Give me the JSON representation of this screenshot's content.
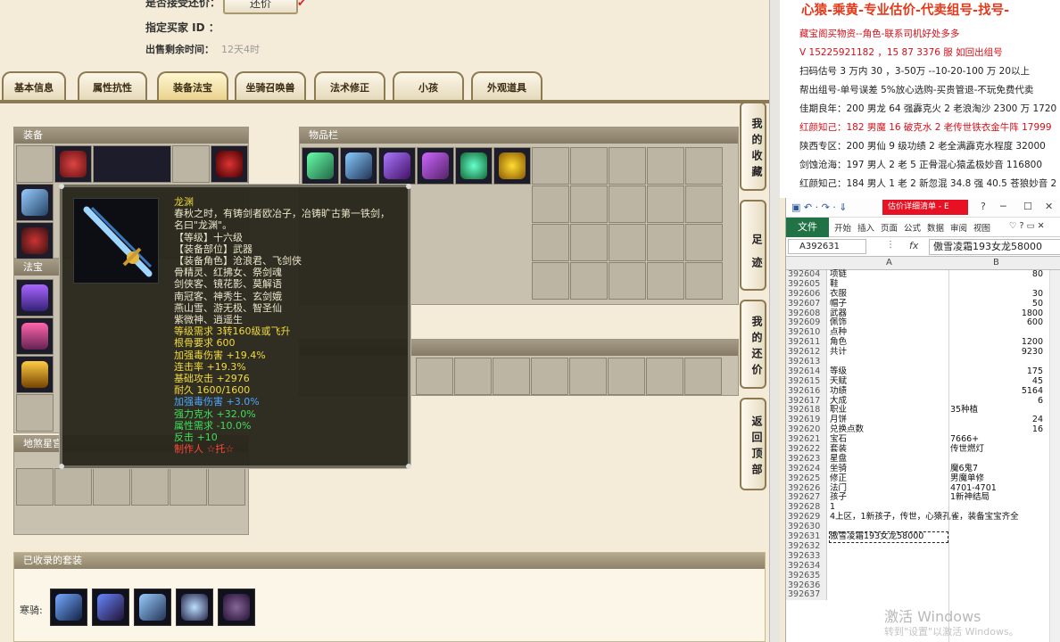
{
  "trade_info": {
    "accept_counter_label": "是否接受还价：",
    "counter_button": "还价",
    "counter_mark": "✔",
    "buyer_label": "指定买家 ID ：",
    "remaining_label": "出售剩余时间：",
    "remaining_value": "12天4时"
  },
  "tabs": [
    {
      "label": "基本信息"
    },
    {
      "label": "属性抗性"
    },
    {
      "label": "装备法宝"
    },
    {
      "label": "坐骑召唤兽"
    },
    {
      "label": "法术修正"
    },
    {
      "label": "小孩"
    },
    {
      "label": "外观道具"
    }
  ],
  "panels": {
    "equipment": "装备",
    "treasure": "法宝",
    "star_palace": "地煞星宫",
    "inventory": "物品栏",
    "collected_sets": "已收录的套装",
    "set_name": "寒骑:"
  },
  "side_buttons": {
    "favorites": "我的收藏",
    "footprints": "足迹",
    "my_offers": "我的还价",
    "back_top": "返回顶部"
  },
  "tooltip": {
    "name": "龙渊",
    "lines": [
      {
        "text": "春秋之时，有铸剑者欧冶子，冶铸旷古第一铁剑，",
        "color": "c-white"
      },
      {
        "text": "名曰\"龙渊\"。",
        "color": "c-white"
      },
      {
        "text": "【等级】十六级",
        "color": "c-white"
      },
      {
        "text": "【装备部位】武器",
        "color": "c-white"
      },
      {
        "text": "【装备角色】沧浪君、飞剑侠",
        "color": "c-white"
      },
      {
        "text": "骨精灵、红拂女、祭剑魂",
        "color": "c-white"
      },
      {
        "text": "剑侠客、镜花影、莫解语",
        "color": "c-white"
      },
      {
        "text": "南冠客、神秀生、玄剑娥",
        "color": "c-white"
      },
      {
        "text": "燕山雪、游无极、智圣仙",
        "color": "c-white"
      },
      {
        "text": "紫微神、逍遥生",
        "color": "c-white"
      },
      {
        "text": "等级需求 3转160级或飞升",
        "color": "c-yellow"
      },
      {
        "text": "根骨要求 600",
        "color": "c-yellow"
      },
      {
        "text": "加强毒伤害 +19.4%",
        "color": "c-yellow"
      },
      {
        "text": "连击率 +19.3%",
        "color": "c-yellow"
      },
      {
        "text": "基础攻击 +2976",
        "color": "c-yellow"
      },
      {
        "text": "耐久 1600/1600",
        "color": "c-yellow"
      },
      {
        "text": "加强毒伤害 +3.0%",
        "color": "c-blue"
      },
      {
        "text": "强力克水 +32.0%",
        "color": "c-green"
      },
      {
        "text": "属性需求 -10.0%",
        "color": "c-green"
      },
      {
        "text": "反击 +10",
        "color": "c-green"
      },
      {
        "text": "制作人 ☆托☆",
        "color": "c-red"
      }
    ]
  },
  "ad": {
    "title": "心猿-乘黄-专业估价-代卖组号-找号-",
    "lines": [
      {
        "text": "藏宝阁买物资--角色-联系司机好处多多",
        "red": true
      },
      {
        "text": "V 15225921182 ，15 87 3376 服  如回出组号",
        "red": true
      },
      {
        "text": "扫码估号 3 万内 30 ，3-50万 --10-20-100 万  20以上",
        "red": false
      },
      {
        "text": "帮出组号-单号误差 5%放心选购-买贵管退-不玩免费代卖",
        "red": false
      },
      {
        "text": "佳期良年：200 男龙 64 强霹克火 2 老浪淘沙 2300 万 1720",
        "red": false
      },
      {
        "text": "红颜知己：182 男魔 16 破克水 2 老传世铁衣金牛阵 17999",
        "red": true
      },
      {
        "text": "陕西专区：200 男仙 9 级功绩 2 老全满霹克水程度 32000",
        "red": false
      },
      {
        "text": "剑蚀沧海：197 男人 2 老 5 正骨混心猿孟极妙音 116800",
        "red": false
      },
      {
        "text": "红颜知己：184 男人 1 老 2 新忽混 34.8 强 40.5 苍狼妙音 2",
        "red": false
      }
    ]
  },
  "excel": {
    "quick_access": "▣ ↶ · ↷ · ⇓",
    "window_name": "估价详细清单 - E",
    "file_tab": "文件",
    "ribbon_tabs": [
      "开始",
      "插入",
      "页面",
      "公式",
      "数据",
      "审阅",
      "视图"
    ],
    "name_box": "A392631",
    "fx": "fx",
    "formula": "傲雪凌霜193女龙58000",
    "col_a": "A",
    "col_b": "B",
    "rows": [
      {
        "n": "392604",
        "a": "项链",
        "b": "80",
        "num": true
      },
      {
        "n": "392605",
        "a": "鞋",
        "b": "",
        "num": true
      },
      {
        "n": "392606",
        "a": "衣服",
        "b": "30",
        "num": true
      },
      {
        "n": "392607",
        "a": "帽子",
        "b": "50",
        "num": true
      },
      {
        "n": "392608",
        "a": "武器",
        "b": "1800",
        "num": true
      },
      {
        "n": "392609",
        "a": "佩饰",
        "b": "600",
        "num": true
      },
      {
        "n": "392610",
        "a": "点种",
        "b": "",
        "num": true
      },
      {
        "n": "392611",
        "a": "角色",
        "b": "1200",
        "num": true
      },
      {
        "n": "392612",
        "a": "共计",
        "b": "9230",
        "num": true
      },
      {
        "n": "392613",
        "a": "",
        "b": "",
        "num": true
      },
      {
        "n": "392614",
        "a": "等级",
        "b": "175",
        "num": true
      },
      {
        "n": "392615",
        "a": "天赋",
        "b": "45",
        "num": true
      },
      {
        "n": "392616",
        "a": "功绩",
        "b": "5164",
        "num": true
      },
      {
        "n": "392617",
        "a": "大成",
        "b": "6",
        "num": true
      },
      {
        "n": "392618",
        "a": "职业",
        "b": "35种植",
        "num": false
      },
      {
        "n": "392619",
        "a": "月饼",
        "b": "24",
        "num": true
      },
      {
        "n": "392620",
        "a": "兑换点数",
        "b": "16",
        "num": true
      },
      {
        "n": "392621",
        "a": "宝石",
        "b": "7666+",
        "num": false
      },
      {
        "n": "392622",
        "a": "套装",
        "b": "传世燃灯",
        "num": false
      },
      {
        "n": "392623",
        "a": "星盘",
        "b": "",
        "num": false
      },
      {
        "n": "392624",
        "a": "坐骑",
        "b": "魔6鬼7",
        "num": false
      },
      {
        "n": "392625",
        "a": "修正",
        "b": "男魔单修",
        "num": false
      },
      {
        "n": "392626",
        "a": "法门",
        "b": "4701-4701",
        "num": false
      },
      {
        "n": "392627",
        "a": "孩子",
        "b": "1新神结局",
        "num": false
      },
      {
        "n": "392628",
        "a": "                    1",
        "b": "",
        "num": false
      },
      {
        "n": "392629",
        "a": "4上区，1新孩子，传世，心猿孔雀，装备宝宝齐全",
        "b": "",
        "num": false
      },
      {
        "n": "392630",
        "a": "",
        "b": "",
        "num": false
      },
      {
        "n": "392631",
        "a": "傲雪凌霜193女龙58000",
        "b": "",
        "num": false
      },
      {
        "n": "392632",
        "a": "",
        "b": "",
        "num": false
      },
      {
        "n": "392633",
        "a": "",
        "b": "",
        "num": false
      },
      {
        "n": "392634",
        "a": "",
        "b": "",
        "num": false
      },
      {
        "n": "392635",
        "a": "",
        "b": "",
        "num": false
      },
      {
        "n": "392636",
        "a": "",
        "b": "",
        "num": false
      },
      {
        "n": "392637",
        "a": "",
        "b": "",
        "num": false
      }
    ],
    "watermark": "激活 Windows",
    "watermark_sub": "转到\"设置\"以激活 Windows。"
  }
}
